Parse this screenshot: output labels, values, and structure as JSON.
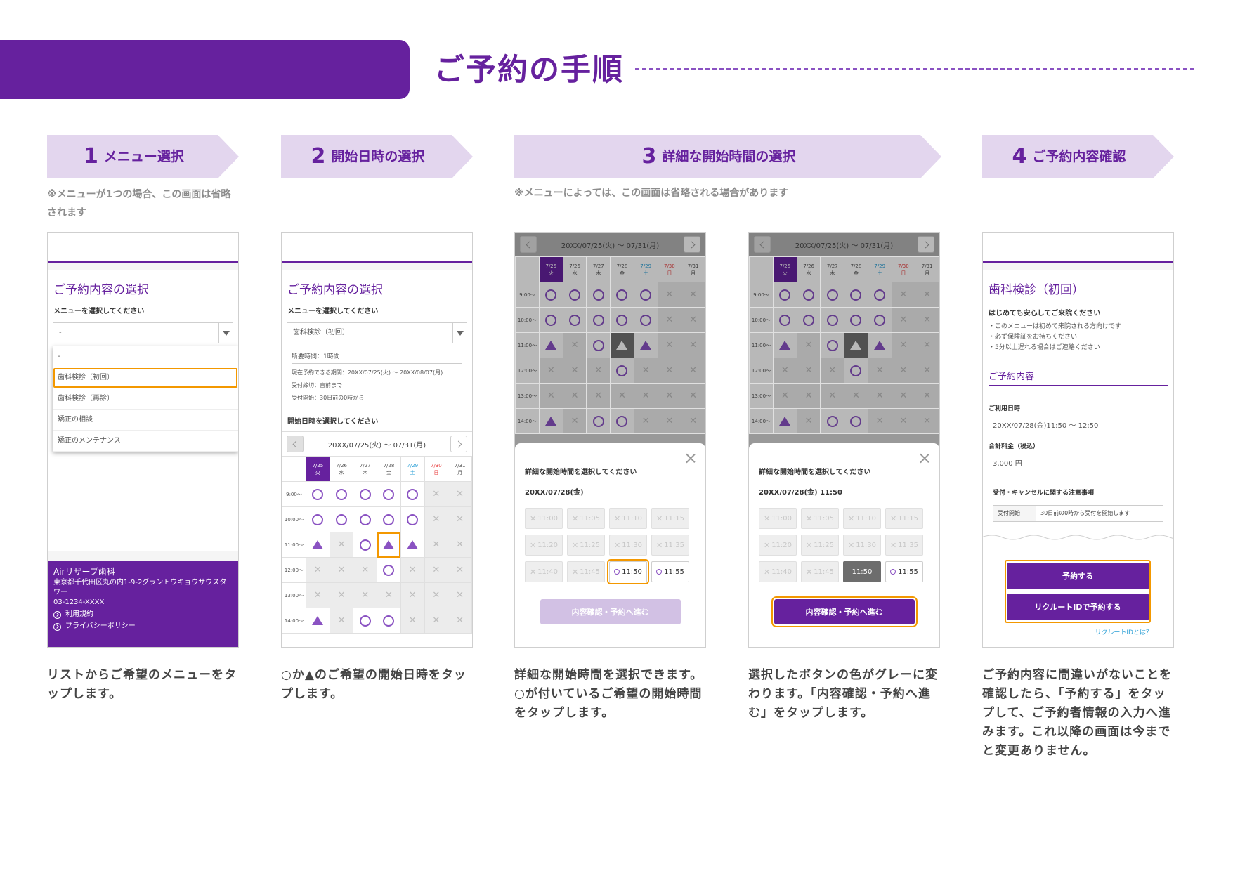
{
  "header": {
    "title": "ご予約の手順"
  },
  "steps": [
    {
      "num": "1",
      "label": "メニュー選択",
      "note": "※メニューが1つの場合、この画面は省略されます",
      "desc": "リストからご希望のメニューをタップします。"
    },
    {
      "num": "2",
      "label": "開始日時の選択",
      "desc": "○か▲のご希望の開始日時をタップします。"
    },
    {
      "num": "3",
      "label": "詳細な開始時間の選択",
      "note": "※メニューによっては、この画面は省略される場合があります",
      "desc_a": "詳細な開始時間を選択できます。○が付いているご希望の開始時間をタップします。",
      "desc_b": "選択したボタンの色がグレーに変わります。「内容確認・予約へ進む」をタップします。"
    },
    {
      "num": "4",
      "label": "ご予約内容確認",
      "desc": "ご予約内容に間違いがないことを確認したら、「予約する」をタップして、ご予約者情報の入力へ進みます。これ以降の画面は今までと変更ありません。"
    }
  ],
  "screen1": {
    "heading": "ご予約内容の選択",
    "prompt": "メニューを選択してください",
    "select_value": "-",
    "options": [
      "-",
      "歯科検診（初回）",
      "歯科検診（再診）",
      "矯正の相談",
      "矯正のメンテナンス"
    ],
    "footer": {
      "clinic": "Airリザーブ歯科",
      "address": "東京都千代田区丸の内1-9-2グラントウキョウサウスタワー",
      "phone": "03-1234-XXXX",
      "terms": "利用規約",
      "privacy": "プライバシーポリシー"
    }
  },
  "screen2": {
    "heading": "ご予約内容の選択",
    "prompt": "メニューを選択してください",
    "select_value": "歯科検診（初回）",
    "duration": "所要時間：1時間",
    "period": "現在予約できる期間：20XX/07/25(火) 〜 20XX/08/07(月)",
    "deadline": "受付締切：直前まで",
    "opening": "受付開始：30日前の0時から",
    "date_prompt": "開始日時を選択してください"
  },
  "calendar": {
    "range": "20XX/07/25(火) 〜 07/31(月)",
    "days": [
      {
        "date": "7/25",
        "dow": "火"
      },
      {
        "date": "7/26",
        "dow": "水"
      },
      {
        "date": "7/27",
        "dow": "木"
      },
      {
        "date": "7/28",
        "dow": "金"
      },
      {
        "date": "7/29",
        "dow": "土"
      },
      {
        "date": "7/30",
        "dow": "日"
      },
      {
        "date": "7/31",
        "dow": "月"
      }
    ],
    "times": [
      "9:00〜",
      "10:00〜",
      "11:00〜",
      "12:00〜",
      "13:00〜",
      "14:00〜"
    ],
    "cells": [
      [
        "o",
        "o",
        "o",
        "o",
        "o",
        "x",
        "x"
      ],
      [
        "o",
        "o",
        "o",
        "o",
        "o",
        "x",
        "x"
      ],
      [
        "t",
        "x",
        "o",
        "t",
        "t",
        "x",
        "x"
      ],
      [
        "x",
        "x",
        "x",
        "o",
        "x",
        "x",
        "x"
      ],
      [
        "x",
        "x",
        "x",
        "x",
        "x",
        "x",
        "x"
      ],
      [
        "t",
        "x",
        "o",
        "o",
        "x",
        "x",
        "x"
      ]
    ]
  },
  "modal": {
    "title": "詳細な開始時間を選択してください",
    "date_a": "20XX/07/28(金)",
    "date_b": "20XX/07/28(金) 11:50",
    "slots": [
      "11:00",
      "11:05",
      "11:10",
      "11:15",
      "11:20",
      "11:25",
      "11:30",
      "11:35",
      "11:40",
      "11:45",
      "11:50",
      "11:55"
    ],
    "button": "内容確認・予約へ進む"
  },
  "screen4": {
    "heading": "歯科検診（初回）",
    "sub": "はじめても安心してご来院ください",
    "bullets": [
      "・このメニューは初めて来院される方向けです",
      "・必ず保険証をお持ちください",
      "・5分以上遅れる場合はご連絡ください"
    ],
    "section": "ご予約内容",
    "date_label": "ご利用日時",
    "date_value": "20XX/07/28(金)11:50 〜 12:50",
    "price_label": "合計料金（税込）",
    "price_value": "3,000 円",
    "notice": "受付・キャンセルに関する注意事項",
    "row_key": "受付開始",
    "row_value": "30日前の0時から受付を開始します",
    "btn_reserve": "予約する",
    "btn_recruit": "リクルートIDで予約する",
    "link": "リクルートIDとは？"
  },
  "colors": {
    "brand": "#66219e",
    "highlight": "#f39800",
    "ribbon": "#e3d6ee"
  }
}
